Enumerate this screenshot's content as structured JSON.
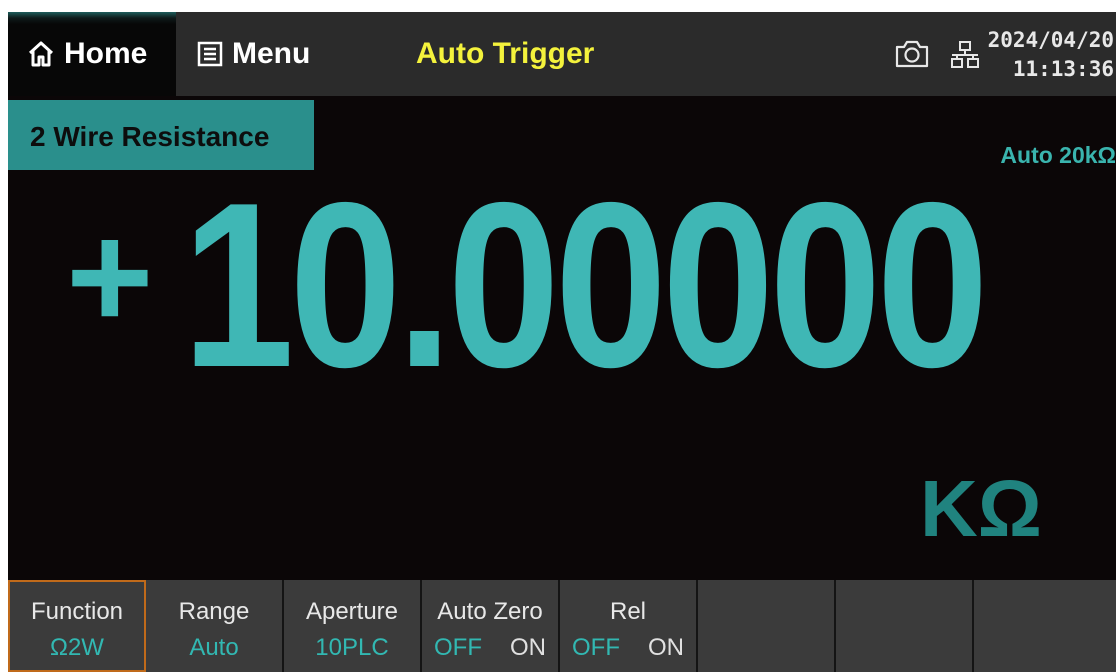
{
  "topbar": {
    "home_label": "Home",
    "menu_label": "Menu",
    "trigger_mode": "Auto Trigger",
    "date": "2024/04/20",
    "time": "11:13:36"
  },
  "measurement": {
    "function_name": "2 Wire Resistance",
    "range_indicator": "Auto 20kΩ",
    "sign": "+",
    "value": "10.00000",
    "unit": "KΩ"
  },
  "softkeys": {
    "function": {
      "label": "Function",
      "value": "Ω2W"
    },
    "range": {
      "label": "Range",
      "value": "Auto"
    },
    "aperture": {
      "label": "Aperture",
      "value": "10PLC"
    },
    "auto_zero": {
      "label": "Auto Zero",
      "off": "OFF",
      "on": "ON",
      "selected": "OFF"
    },
    "rel": {
      "label": "Rel",
      "off": "OFF",
      "on": "ON",
      "selected": "OFF"
    }
  },
  "icons": {
    "home": "home-icon",
    "menu": "menu-list-icon",
    "screenshot": "camera-icon",
    "network": "network-icon"
  },
  "colors": {
    "accent": "#3fb7b5",
    "trigger": "#f4f23c",
    "active_softkey_border": "#c06a1a",
    "function_label_bg": "#2a8f8c"
  }
}
